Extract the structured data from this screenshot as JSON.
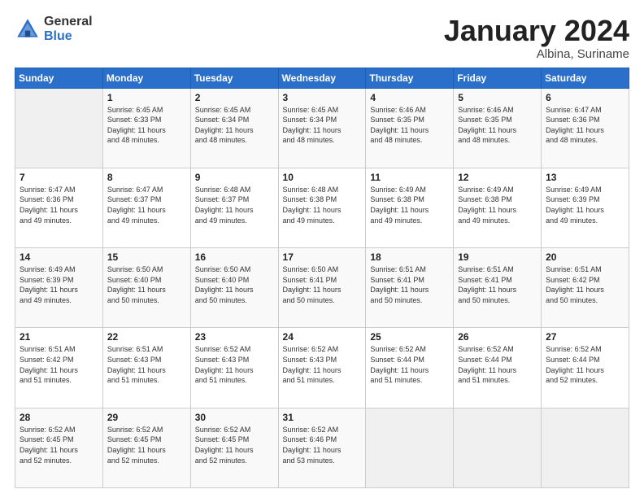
{
  "logo": {
    "general": "General",
    "blue": "Blue"
  },
  "header": {
    "title": "January 2024",
    "subtitle": "Albina, Suriname"
  },
  "days_of_week": [
    "Sunday",
    "Monday",
    "Tuesday",
    "Wednesday",
    "Thursday",
    "Friday",
    "Saturday"
  ],
  "weeks": [
    [
      {
        "day": "",
        "info": ""
      },
      {
        "day": "1",
        "info": "Sunrise: 6:45 AM\nSunset: 6:33 PM\nDaylight: 11 hours\nand 48 minutes."
      },
      {
        "day": "2",
        "info": "Sunrise: 6:45 AM\nSunset: 6:34 PM\nDaylight: 11 hours\nand 48 minutes."
      },
      {
        "day": "3",
        "info": "Sunrise: 6:45 AM\nSunset: 6:34 PM\nDaylight: 11 hours\nand 48 minutes."
      },
      {
        "day": "4",
        "info": "Sunrise: 6:46 AM\nSunset: 6:35 PM\nDaylight: 11 hours\nand 48 minutes."
      },
      {
        "day": "5",
        "info": "Sunrise: 6:46 AM\nSunset: 6:35 PM\nDaylight: 11 hours\nand 48 minutes."
      },
      {
        "day": "6",
        "info": "Sunrise: 6:47 AM\nSunset: 6:36 PM\nDaylight: 11 hours\nand 48 minutes."
      }
    ],
    [
      {
        "day": "7",
        "info": "Sunrise: 6:47 AM\nSunset: 6:36 PM\nDaylight: 11 hours\nand 49 minutes."
      },
      {
        "day": "8",
        "info": "Sunrise: 6:47 AM\nSunset: 6:37 PM\nDaylight: 11 hours\nand 49 minutes."
      },
      {
        "day": "9",
        "info": "Sunrise: 6:48 AM\nSunset: 6:37 PM\nDaylight: 11 hours\nand 49 minutes."
      },
      {
        "day": "10",
        "info": "Sunrise: 6:48 AM\nSunset: 6:38 PM\nDaylight: 11 hours\nand 49 minutes."
      },
      {
        "day": "11",
        "info": "Sunrise: 6:49 AM\nSunset: 6:38 PM\nDaylight: 11 hours\nand 49 minutes."
      },
      {
        "day": "12",
        "info": "Sunrise: 6:49 AM\nSunset: 6:38 PM\nDaylight: 11 hours\nand 49 minutes."
      },
      {
        "day": "13",
        "info": "Sunrise: 6:49 AM\nSunset: 6:39 PM\nDaylight: 11 hours\nand 49 minutes."
      }
    ],
    [
      {
        "day": "14",
        "info": "Sunrise: 6:49 AM\nSunset: 6:39 PM\nDaylight: 11 hours\nand 49 minutes."
      },
      {
        "day": "15",
        "info": "Sunrise: 6:50 AM\nSunset: 6:40 PM\nDaylight: 11 hours\nand 50 minutes."
      },
      {
        "day": "16",
        "info": "Sunrise: 6:50 AM\nSunset: 6:40 PM\nDaylight: 11 hours\nand 50 minutes."
      },
      {
        "day": "17",
        "info": "Sunrise: 6:50 AM\nSunset: 6:41 PM\nDaylight: 11 hours\nand 50 minutes."
      },
      {
        "day": "18",
        "info": "Sunrise: 6:51 AM\nSunset: 6:41 PM\nDaylight: 11 hours\nand 50 minutes."
      },
      {
        "day": "19",
        "info": "Sunrise: 6:51 AM\nSunset: 6:41 PM\nDaylight: 11 hours\nand 50 minutes."
      },
      {
        "day": "20",
        "info": "Sunrise: 6:51 AM\nSunset: 6:42 PM\nDaylight: 11 hours\nand 50 minutes."
      }
    ],
    [
      {
        "day": "21",
        "info": "Sunrise: 6:51 AM\nSunset: 6:42 PM\nDaylight: 11 hours\nand 51 minutes."
      },
      {
        "day": "22",
        "info": "Sunrise: 6:51 AM\nSunset: 6:43 PM\nDaylight: 11 hours\nand 51 minutes."
      },
      {
        "day": "23",
        "info": "Sunrise: 6:52 AM\nSunset: 6:43 PM\nDaylight: 11 hours\nand 51 minutes."
      },
      {
        "day": "24",
        "info": "Sunrise: 6:52 AM\nSunset: 6:43 PM\nDaylight: 11 hours\nand 51 minutes."
      },
      {
        "day": "25",
        "info": "Sunrise: 6:52 AM\nSunset: 6:44 PM\nDaylight: 11 hours\nand 51 minutes."
      },
      {
        "day": "26",
        "info": "Sunrise: 6:52 AM\nSunset: 6:44 PM\nDaylight: 11 hours\nand 51 minutes."
      },
      {
        "day": "27",
        "info": "Sunrise: 6:52 AM\nSunset: 6:44 PM\nDaylight: 11 hours\nand 52 minutes."
      }
    ],
    [
      {
        "day": "28",
        "info": "Sunrise: 6:52 AM\nSunset: 6:45 PM\nDaylight: 11 hours\nand 52 minutes."
      },
      {
        "day": "29",
        "info": "Sunrise: 6:52 AM\nSunset: 6:45 PM\nDaylight: 11 hours\nand 52 minutes."
      },
      {
        "day": "30",
        "info": "Sunrise: 6:52 AM\nSunset: 6:45 PM\nDaylight: 11 hours\nand 52 minutes."
      },
      {
        "day": "31",
        "info": "Sunrise: 6:52 AM\nSunset: 6:46 PM\nDaylight: 11 hours\nand 53 minutes."
      },
      {
        "day": "",
        "info": ""
      },
      {
        "day": "",
        "info": ""
      },
      {
        "day": "",
        "info": ""
      }
    ]
  ]
}
